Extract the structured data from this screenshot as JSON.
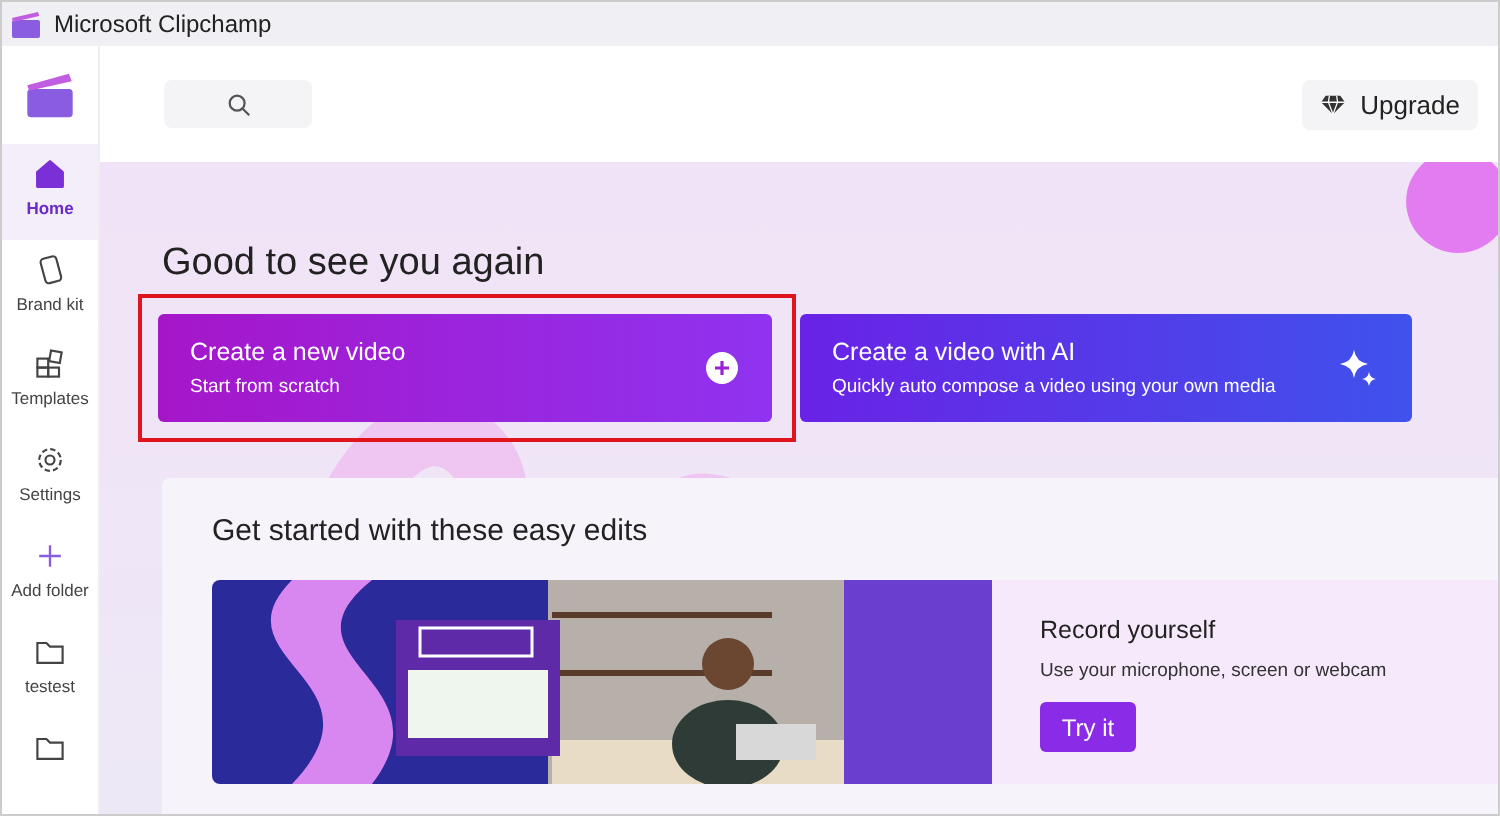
{
  "window": {
    "title": "Microsoft Clipchamp"
  },
  "sidebar": {
    "items": [
      {
        "kind": "home",
        "label": "Home",
        "selected": true
      },
      {
        "kind": "brand",
        "label": "Brand kit",
        "selected": false
      },
      {
        "kind": "templates",
        "label": "Templates",
        "selected": false
      },
      {
        "kind": "settings",
        "label": "Settings",
        "selected": false
      },
      {
        "kind": "add",
        "label": "Add folder",
        "selected": false
      },
      {
        "kind": "folder",
        "label": "testest",
        "selected": false
      },
      {
        "kind": "folder",
        "selected": false
      }
    ]
  },
  "header": {
    "upgrade_button": "Upgrade"
  },
  "greeting": "Good to see you again",
  "actions": [
    {
      "kind": "new",
      "title": "Create a new video",
      "subtitle": "Start from scratch",
      "highlighted": true
    },
    {
      "kind": "ai",
      "title": "Create a video with AI",
      "subtitle": "Quickly auto compose a video using your own media",
      "highlighted": false
    }
  ],
  "easy_edits": {
    "title": "Get started with these easy edits",
    "card": {
      "kind": "picture",
      "title": "Record yourself",
      "description": "Use your microphone, screen or webcam",
      "button": "Try it"
    }
  }
}
